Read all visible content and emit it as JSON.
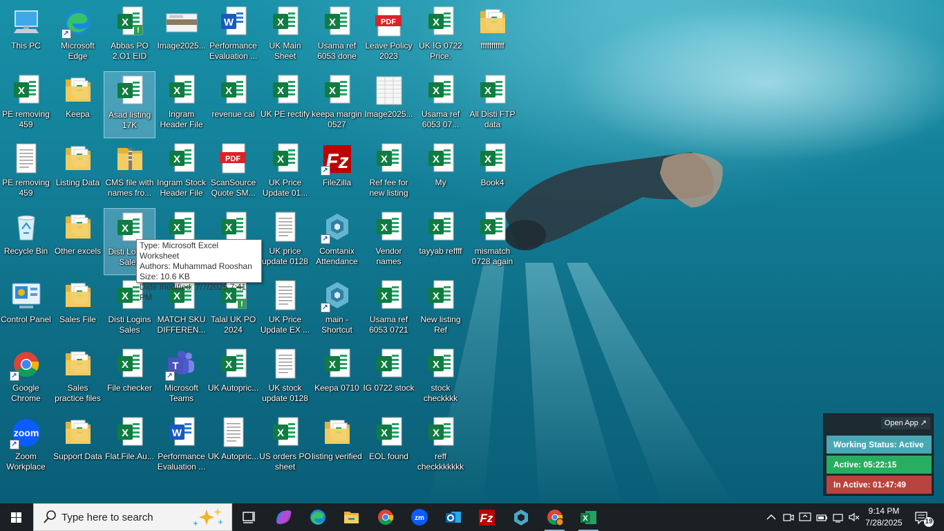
{
  "desktop": {
    "icons": [
      {
        "label": "This PC",
        "type": "pc"
      },
      {
        "label": "Microsoft Edge",
        "type": "edge"
      },
      {
        "label": "Abbas PO 2.O1  EID",
        "type": "excel-alert"
      },
      {
        "label": "Image2025...",
        "type": "image-thumb"
      },
      {
        "label": "Performance Evaluation ...",
        "type": "word"
      },
      {
        "label": "UK Main Sheet",
        "type": "excel"
      },
      {
        "label": "Usama ref 6053 done",
        "type": "excel"
      },
      {
        "label": "Leave Policy 2023",
        "type": "pdf"
      },
      {
        "label": "UK IG 0722 Price.",
        "type": "excel"
      },
      {
        "label": "fffffffffff",
        "type": "folder"
      },
      {
        "label": "PE removing 459",
        "type": "excel"
      },
      {
        "label": "Keepa",
        "type": "folder"
      },
      {
        "label": "Asad listing 17K",
        "type": "excel"
      },
      {
        "label": "Ingram Header File",
        "type": "excel"
      },
      {
        "label": "revenue cal",
        "type": "excel"
      },
      {
        "label": "UK PE rectify",
        "type": "excel"
      },
      {
        "label": "keepa margin 0527",
        "type": "excel"
      },
      {
        "label": "Image2025...",
        "type": "sheet-thumb"
      },
      {
        "label": "Usama ref 6053 07...",
        "type": "excel"
      },
      {
        "label": "All Disti FTP data",
        "type": "excel"
      },
      {
        "label": "PE removing 459",
        "type": "text"
      },
      {
        "label": "Listing Data",
        "type": "folder"
      },
      {
        "label": "CMS file with names fro...",
        "type": "zip"
      },
      {
        "label": "Ingram Stock Header File",
        "type": "excel"
      },
      {
        "label": "ScanSource Quote SM...",
        "type": "pdf"
      },
      {
        "label": "UK Price Update 01...",
        "type": "excel"
      },
      {
        "label": "FileZilla",
        "type": "filezilla"
      },
      {
        "label": "Ref fee for new listing",
        "type": "excel"
      },
      {
        "label": "My",
        "type": "excel"
      },
      {
        "label": "Book4",
        "type": "excel"
      },
      {
        "label": "Recycle Bin",
        "type": "recycle"
      },
      {
        "label": "Other excels",
        "type": "folder"
      },
      {
        "label": "Disti Logins Sales",
        "type": "excel"
      },
      {
        "label": "",
        "type": "excel"
      },
      {
        "label": "",
        "type": "excel"
      },
      {
        "label": "UK price update 0128",
        "type": "text"
      },
      {
        "label": "Comtanix Attendance",
        "type": "comtanix"
      },
      {
        "label": "Vendor names",
        "type": "excel"
      },
      {
        "label": "tayyab reffff",
        "type": "excel"
      },
      {
        "label": "mismatch 0728 again",
        "type": "excel"
      },
      {
        "label": "Control Panel",
        "type": "control"
      },
      {
        "label": "Sales File",
        "type": "folder"
      },
      {
        "label": "Disti Logins Sales",
        "type": "excel"
      },
      {
        "label": "MATCH SKU DIFFEREN...",
        "type": "excel"
      },
      {
        "label": "Talal UK PO 2024",
        "type": "excel-alert"
      },
      {
        "label": "UK Price Update EX ...",
        "type": "text"
      },
      {
        "label": "main - Shortcut",
        "type": "comtanix"
      },
      {
        "label": "Usama ref 6053 0721",
        "type": "excel"
      },
      {
        "label": "New listing Ref",
        "type": "excel"
      },
      {
        "label": "Google Chrome",
        "type": "chrome"
      },
      {
        "label": "Sales practice files",
        "type": "folder"
      },
      {
        "label": "File checker",
        "type": "excel"
      },
      {
        "label": "Microsoft Teams",
        "type": "teams"
      },
      {
        "label": "UK Autopric...",
        "type": "excel"
      },
      {
        "label": "UK stock update 0128",
        "type": "text"
      },
      {
        "label": "Keepa 0710",
        "type": "excel"
      },
      {
        "label": "IG 0722 stock",
        "type": "excel"
      },
      {
        "label": "stock checkkkk",
        "type": "excel"
      },
      {
        "label": "Zoom Workplace",
        "type": "zoom"
      },
      {
        "label": "Support Data",
        "type": "folder"
      },
      {
        "label": "Flat.File.Au...",
        "type": "excel"
      },
      {
        "label": "Performance Evaluation ...",
        "type": "word"
      },
      {
        "label": "UK Autopric...",
        "type": "text"
      },
      {
        "label": "US orders PO sheet",
        "type": "excel"
      },
      {
        "label": "listing verified",
        "type": "folder"
      },
      {
        "label": "EOL found",
        "type": "excel"
      },
      {
        "label": "reff checkkkkkkk",
        "type": "excel"
      }
    ]
  },
  "tooltip": {
    "line1": "Type: Microsoft Excel Worksheet",
    "line2": "Authors: Muhammad Rooshan",
    "line3": "Size: 10.6 KB",
    "line4": "Date modified: 7/7/2025 7:41 PM"
  },
  "widget": {
    "open_app": "Open App ↗",
    "working_status": "Working Status: Active",
    "active": "Active: 05:22:15",
    "inactive": "In Active: 01:47:49",
    "colors": {
      "status": "#4aa8b4",
      "active": "#27ae60",
      "inactive": "#b9443f"
    }
  },
  "taskbar": {
    "search_placeholder": "Type here to search",
    "apps": [
      "task-view",
      "copilot",
      "edge",
      "file-explorer",
      "chrome",
      "zoom",
      "outlook",
      "filezilla",
      "comtanix",
      "chrome-profile",
      "excel"
    ],
    "time": "9:14 PM",
    "date": "7/28/2025",
    "notification_count": "19"
  }
}
